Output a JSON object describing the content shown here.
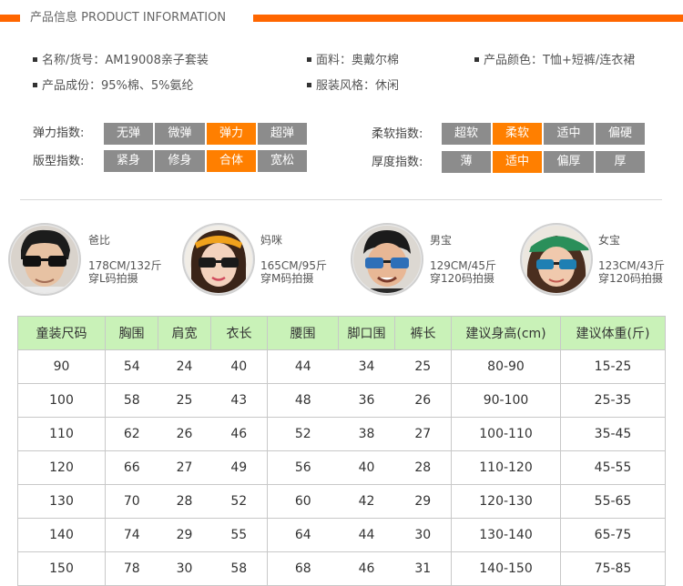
{
  "header": {
    "title": "产品信息  PRODUCT INFORMATION"
  },
  "info": {
    "item1": "名称/货号：AM19008亲子套装",
    "item2": "面料：奥戴尔棉",
    "item3": "产品颜色：T恤+短裤/连衣裙",
    "item4": "产品成份：95%棉、5%氨纶",
    "item5": "服装风格：休闲"
  },
  "indices": {
    "elasticity": {
      "label": "弹力指数:",
      "options": [
        "无弹",
        "微弹",
        "弹力",
        "超弹"
      ],
      "selected": "弹力"
    },
    "softness": {
      "label": "柔软指数:",
      "options": [
        "超软",
        "柔软",
        "适中",
        "偏硬"
      ],
      "selected": "柔软"
    },
    "fit": {
      "label": "版型指数:",
      "options": [
        "紧身",
        "修身",
        "合体",
        "宽松"
      ],
      "selected": "合体"
    },
    "thickness": {
      "label": "厚度指数:",
      "options": [
        "薄",
        "适中",
        "偏厚",
        "厚"
      ],
      "selected": "适中"
    }
  },
  "models": [
    {
      "name": "爸比",
      "size": "178CM/132斤",
      "wear": "穿L码拍摄"
    },
    {
      "name": "妈咪",
      "size": "165CM/95斤",
      "wear": "穿M码拍摄"
    },
    {
      "name": "男宝",
      "size": "129CM/45斤",
      "wear": "穿120码拍摄"
    },
    {
      "name": "女宝",
      "size": "123CM/43斤",
      "wear": "穿120码拍摄"
    }
  ],
  "size_table": {
    "headers": [
      "童装尺码",
      "胸围",
      "肩宽",
      "衣长",
      "腰围",
      "脚口围",
      "裤长",
      "建议身高(cm)",
      "建议体重(斤)"
    ],
    "rows": [
      [
        "90",
        "54",
        "24",
        "40",
        "44",
        "34",
        "25",
        "80-90",
        "15-25"
      ],
      [
        "100",
        "58",
        "25",
        "43",
        "48",
        "36",
        "26",
        "90-100",
        "25-35"
      ],
      [
        "110",
        "62",
        "26",
        "46",
        "52",
        "38",
        "27",
        "100-110",
        "35-45"
      ],
      [
        "120",
        "66",
        "27",
        "49",
        "56",
        "40",
        "28",
        "110-120",
        "45-55"
      ],
      [
        "130",
        "70",
        "28",
        "52",
        "60",
        "42",
        "29",
        "120-130",
        "55-65"
      ],
      [
        "140",
        "74",
        "29",
        "55",
        "64",
        "44",
        "30",
        "130-140",
        "65-75"
      ],
      [
        "150",
        "78",
        "30",
        "58",
        "68",
        "46",
        "31",
        "140-150",
        "75-85"
      ]
    ]
  },
  "colors": {
    "accent": "#ff6600",
    "chip_on": "#ff7f00",
    "chip_off": "#8c8c8c",
    "table_header": "#c9f2b8"
  }
}
